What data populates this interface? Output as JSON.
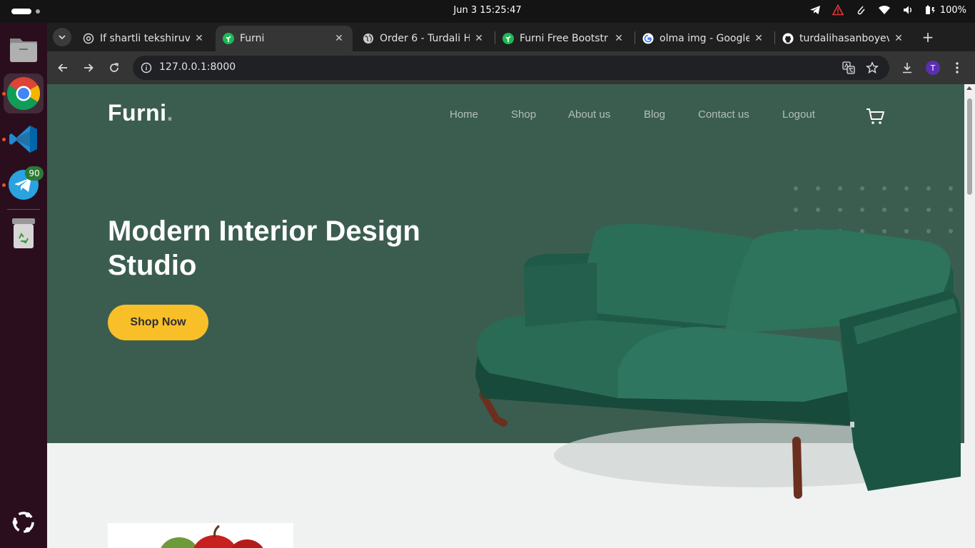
{
  "system": {
    "clock": "Jun 3  15:25:47",
    "battery": "100%",
    "tray_icons": [
      "telegram-icon",
      "warning-icon",
      "clip-icon",
      "wifi-icon",
      "volume-icon",
      "battery-icon"
    ]
  },
  "dock": {
    "items": [
      {
        "name": "files-icon"
      },
      {
        "name": "chrome-icon"
      },
      {
        "name": "vscode-icon"
      },
      {
        "name": "telegram-icon",
        "badge": "90"
      },
      {
        "name": "trash-icon"
      },
      {
        "name": "ubuntu-apps-icon"
      }
    ]
  },
  "tabs": [
    {
      "title": "If shartli tekshiruv",
      "icon": "chatgpt-icon",
      "active": false
    },
    {
      "title": "Furni",
      "icon": "furni-favicon",
      "active": true
    },
    {
      "title": "Order 6 - Turdali H",
      "icon": "globe-icon",
      "active": false
    },
    {
      "title": "Furni Free Bootstr",
      "icon": "furni-favicon",
      "active": false
    },
    {
      "title": "olma img - Google",
      "icon": "google-icon",
      "active": false
    },
    {
      "title": "turdalihasanboyev",
      "icon": "github-icon",
      "active": false
    }
  ],
  "omnibox": {
    "url": "127.0.0.1:8000"
  },
  "profile": {
    "initial": "T"
  },
  "site": {
    "logo": "Furni",
    "logo_dot": ".",
    "nav": [
      "Home",
      "Shop",
      "About us",
      "Blog",
      "Contact us",
      "Logout"
    ],
    "hero_title_line1": "Modern Interior Design",
    "hero_title_line2": "Studio",
    "cta": "Shop Now",
    "colors": {
      "hero_bg": "#3b5d50",
      "cta_bg": "#f9bf29",
      "page_bg": "#eff2f1"
    }
  }
}
